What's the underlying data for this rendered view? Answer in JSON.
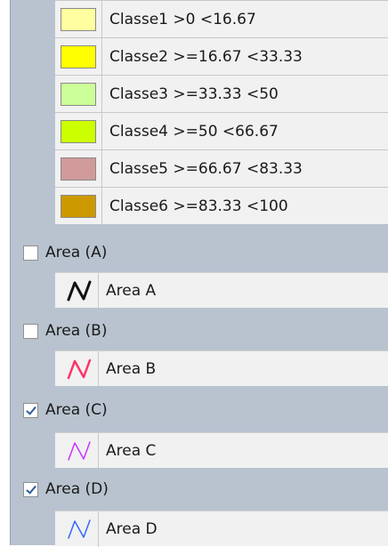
{
  "classes": [
    {
      "label": "Classe1 >0 <16.67",
      "color": "#ffffa0"
    },
    {
      "label": "Classe2 >=16.67 <33.33",
      "color": "#ffff00"
    },
    {
      "label": "Classe3 >=33.33 <50",
      "color": "#ccff99"
    },
    {
      "label": "Classe4 >=50 <66.67",
      "color": "#ccff00"
    },
    {
      "label": "Classe5 >=66.67 <83.33",
      "color": "#d09a9a"
    },
    {
      "label": "Classe6 >=83.33 <100",
      "color": "#cc9900"
    }
  ],
  "areas": [
    {
      "title": "Area (A)",
      "checked": false,
      "legend_label": "Area A",
      "line_color": "#111111",
      "icon": "zigzag-line-icon"
    },
    {
      "title": "Area (B)",
      "checked": false,
      "legend_label": "Area B",
      "line_color": "#ff3366",
      "icon": "zigzag-line-icon"
    },
    {
      "title": "Area (C)",
      "checked": true,
      "legend_label": "Area C",
      "line_color": "#cc33ff",
      "icon": "zigzag-line-icon"
    },
    {
      "title": "Area (D)",
      "checked": true,
      "legend_label": "Area D",
      "line_color": "#3366ff",
      "icon": "zigzag-line-icon"
    }
  ]
}
